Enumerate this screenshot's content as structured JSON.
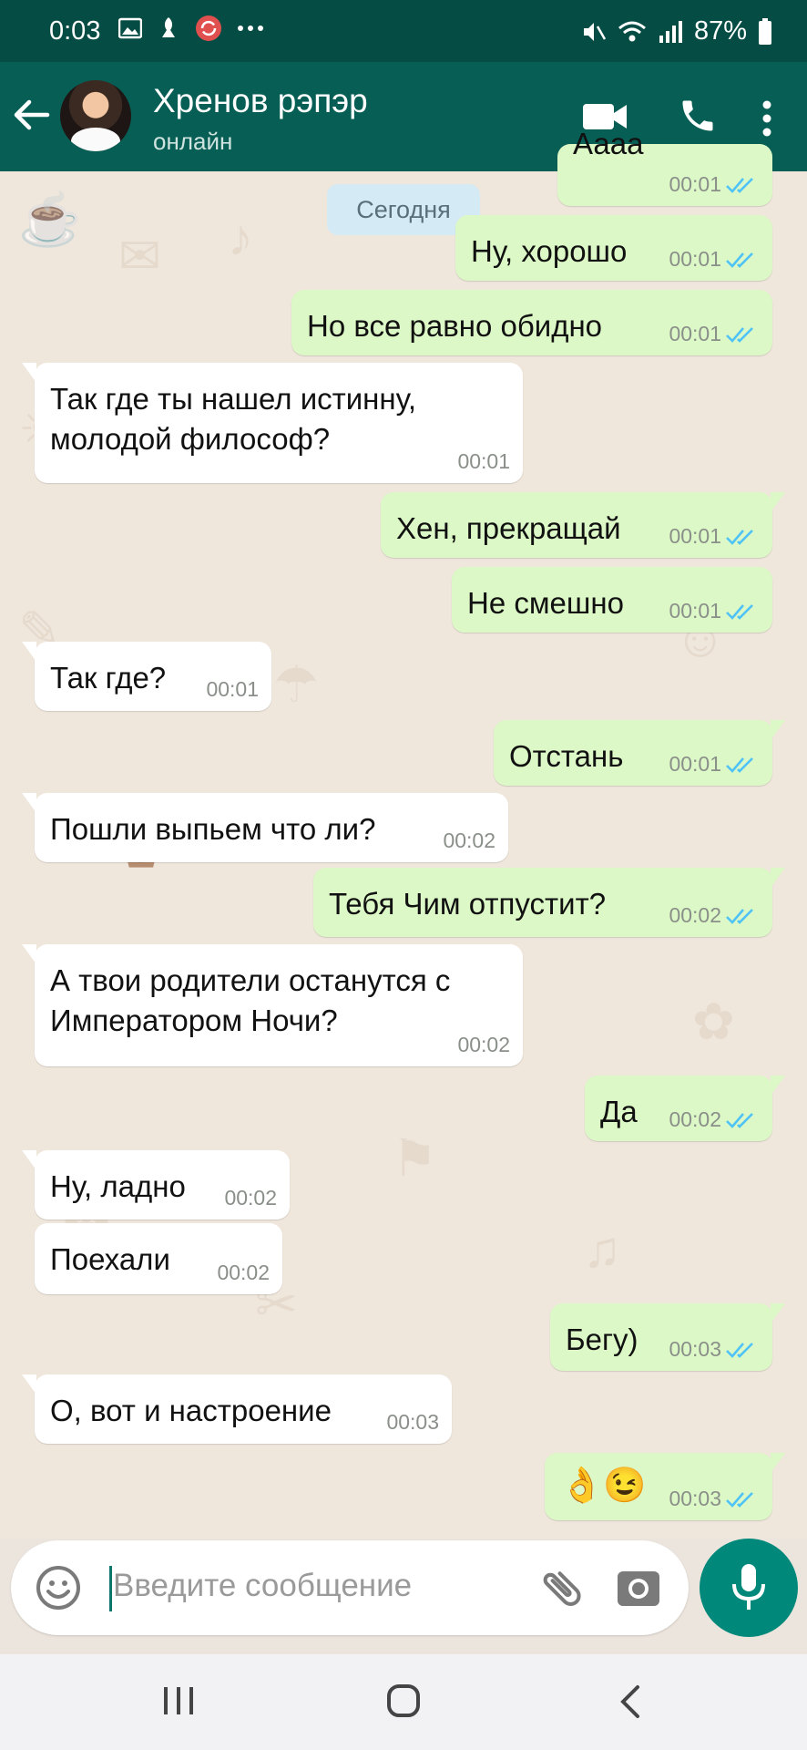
{
  "status_bar": {
    "time": "0:03",
    "battery": "87%"
  },
  "header": {
    "contact_name": "Хренов рэпэр",
    "contact_status": "онлайн"
  },
  "date_chip": "Сегодня",
  "messages": [
    {
      "dir": "out",
      "text": "Аааа",
      "time": "00:01"
    },
    {
      "dir": "out",
      "text": "Ну, хорошо",
      "time": "00:01"
    },
    {
      "dir": "out",
      "text": "Но все равно обидно",
      "time": "00:01"
    },
    {
      "dir": "in",
      "text": "Так где ты нашел истинну,\nмолодой философ?",
      "time": "00:01"
    },
    {
      "dir": "out",
      "text": "Хен, прекращай",
      "time": "00:01"
    },
    {
      "dir": "out",
      "text": "Не смешно",
      "time": "00:01"
    },
    {
      "dir": "in",
      "text": "Так где?",
      "time": "00:01"
    },
    {
      "dir": "out",
      "text": "Отстань",
      "time": "00:01"
    },
    {
      "dir": "in",
      "text": "Пошли выпьем что ли?",
      "time": "00:02"
    },
    {
      "dir": "out",
      "text": "Тебя Чим отпустит?",
      "time": "00:02"
    },
    {
      "dir": "in",
      "text": "А твои родители останутся с\nИмператором Ночи?",
      "time": "00:02"
    },
    {
      "dir": "out",
      "text": "Да",
      "time": "00:02"
    },
    {
      "dir": "in",
      "text": "Ну, ладно",
      "time": "00:02"
    },
    {
      "dir": "in",
      "text": "Поехали",
      "time": "00:02"
    },
    {
      "dir": "out",
      "text": "Бегу)",
      "time": "00:03"
    },
    {
      "dir": "in",
      "text": "О, вот и настроение",
      "time": "00:03"
    },
    {
      "dir": "out",
      "text": "👌😉",
      "time": "00:03"
    }
  ],
  "input": {
    "placeholder": "Введите сообщение"
  },
  "colors": {
    "header": "#075e54",
    "status_bar": "#054d44",
    "outgoing": "#dcf8c6",
    "incoming": "#ffffff",
    "read_tick": "#4fc3f7",
    "fab": "#00897b"
  }
}
